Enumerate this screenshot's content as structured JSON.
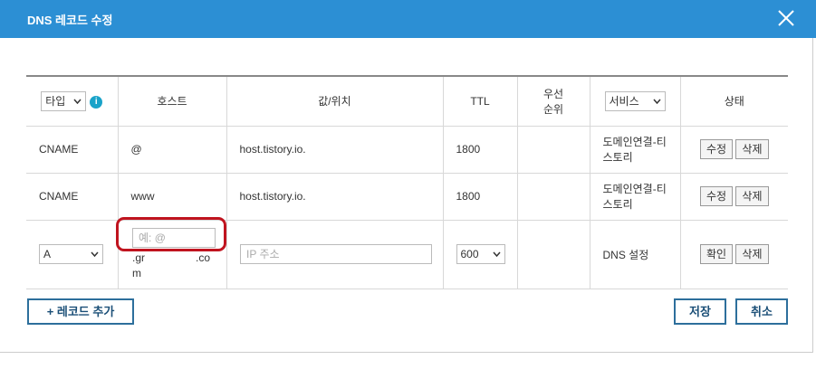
{
  "dialog": {
    "title": "DNS 레코드 수정"
  },
  "table": {
    "headers": {
      "type_select": "타입",
      "host": "호스트",
      "value": "값/위치",
      "ttl": "TTL",
      "priority_line1": "우선",
      "priority_line2": "순위",
      "service_select": "서비스",
      "status": "상태"
    },
    "rows": [
      {
        "type": "CNAME",
        "host": "@",
        "value": "host.tistory.io.",
        "ttl": "1800",
        "service_line1": "도메인연결-티",
        "service_line2": "스토리",
        "edit": "수정",
        "delete": "삭제"
      },
      {
        "type": "CNAME",
        "host": "www",
        "value": "host.tistory.io.",
        "ttl": "1800",
        "service_line1": "도메인연결-티",
        "service_line2": "스토리",
        "edit": "수정",
        "delete": "삭제"
      }
    ],
    "new_row": {
      "type_value": "A",
      "host_placeholder": "예: @",
      "host_suffix_line1": ".gr",
      "host_suffix_line2": ".co",
      "host_suffix_line3": "m",
      "value_placeholder": "IP 주소",
      "ttl_value": "600",
      "service": "DNS 설정",
      "confirm": "확인",
      "delete": "삭제"
    }
  },
  "footer": {
    "add_record": "+ 레코드 추가",
    "save": "저장",
    "cancel": "취소"
  },
  "colors": {
    "titlebar": "#2c8fd4",
    "info_icon": "#1aa3c9",
    "highlight_ring": "#c0141f"
  }
}
